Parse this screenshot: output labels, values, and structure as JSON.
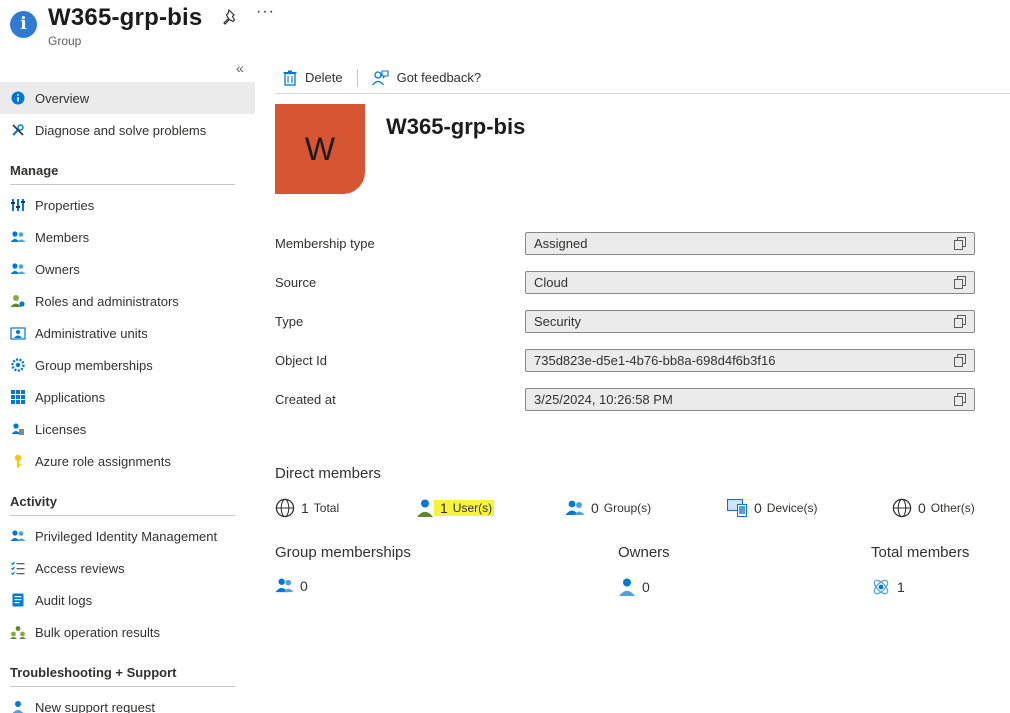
{
  "header": {
    "title": "W365-grp-bis",
    "subtitle": "Group",
    "more": "···"
  },
  "sidebar": {
    "collapse": "«",
    "top_items": [
      {
        "label": "Overview",
        "icon": "info-icon"
      },
      {
        "label": "Diagnose and solve problems",
        "icon": "wrench-icon"
      }
    ],
    "manage_heading": "Manage",
    "manage_items": [
      {
        "label": "Properties",
        "icon": "properties-icon"
      },
      {
        "label": "Members",
        "icon": "members-icon"
      },
      {
        "label": "Owners",
        "icon": "owners-icon"
      },
      {
        "label": "Roles and administrators",
        "icon": "roles-icon"
      },
      {
        "label": "Administrative units",
        "icon": "admin-units-icon"
      },
      {
        "label": "Group memberships",
        "icon": "gear-icon"
      },
      {
        "label": "Applications",
        "icon": "apps-grid-icon"
      },
      {
        "label": "Licenses",
        "icon": "license-icon"
      },
      {
        "label": "Azure role assignments",
        "icon": "key-icon"
      }
    ],
    "activity_heading": "Activity",
    "activity_items": [
      {
        "label": "Privileged Identity Management",
        "icon": "pim-icon"
      },
      {
        "label": "Access reviews",
        "icon": "checklist-icon"
      },
      {
        "label": "Audit logs",
        "icon": "audit-log-icon"
      },
      {
        "label": "Bulk operation results",
        "icon": "bulk-icon"
      }
    ],
    "support_heading": "Troubleshooting + Support",
    "support_items": [
      {
        "label": "New support request",
        "icon": "support-person-icon"
      }
    ]
  },
  "toolbar": {
    "delete_label": "Delete",
    "feedback_label": "Got feedback?"
  },
  "main": {
    "avatar_letter": "W",
    "title": "W365-grp-bis",
    "properties": [
      {
        "label": "Membership type",
        "value": "Assigned"
      },
      {
        "label": "Source",
        "value": "Cloud"
      },
      {
        "label": "Type",
        "value": "Security"
      },
      {
        "label": "Object Id",
        "value": "735d823e-d5e1-4b76-bb8a-698d4f6b3f16"
      },
      {
        "label": "Created at",
        "value": "3/25/2024, 10:26:58 PM"
      }
    ],
    "direct_members": {
      "title": "Direct members",
      "total": {
        "num": "1",
        "label": "Total"
      },
      "users": {
        "num": "1",
        "label": "User(s)"
      },
      "groups": {
        "num": "0",
        "label": "Group(s)"
      },
      "devices": {
        "num": "0",
        "label": "Device(s)"
      },
      "others": {
        "num": "0",
        "label": "Other(s)"
      }
    },
    "summary": {
      "group_memberships": {
        "title": "Group memberships",
        "value": "0"
      },
      "owners": {
        "title": "Owners",
        "value": "0"
      },
      "total_members": {
        "title": "Total members",
        "value": "1"
      }
    }
  },
  "colors": {
    "avatar": "#d65532",
    "highlight": "#f7f33c",
    "accent": "#0078d4"
  }
}
